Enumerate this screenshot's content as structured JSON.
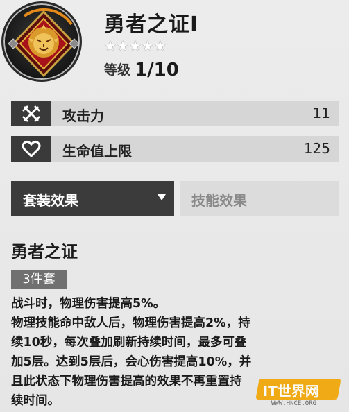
{
  "item": {
    "name": "勇者之证I",
    "stars": "★★★★★",
    "level_label": "等级",
    "level_value": "1/10"
  },
  "stats": [
    {
      "icon": "crossed-swords-icon",
      "label": "攻击力",
      "value": "11"
    },
    {
      "icon": "heart-icon",
      "label": "生命值上限",
      "value": "125"
    }
  ],
  "tabs": {
    "set_effect": "套装效果",
    "skill_effect": "技能效果"
  },
  "set": {
    "name": "勇者之证",
    "pieces_badge": "3件套",
    "description": [
      "战斗时，物理伤害提高5%。",
      "物理技能命中敌人后，物理伤害提高2%，持",
      "续10秒，每次叠加刷新持续时间，最多可叠",
      "加5层。达到5层后，会心伤害提高10%，并",
      "且此状态下物理伤害提高的效果不再重置持",
      "续时间。"
    ]
  },
  "watermark": {
    "logo_text": "IT世界网",
    "url": "WWW.HNCE.ORG"
  },
  "colors": {
    "accent_gold": "#f2a400",
    "emblem_red": "#b3141b",
    "emblem_gold": "#e2b23a",
    "dark_panel": "#3b3b3b"
  }
}
